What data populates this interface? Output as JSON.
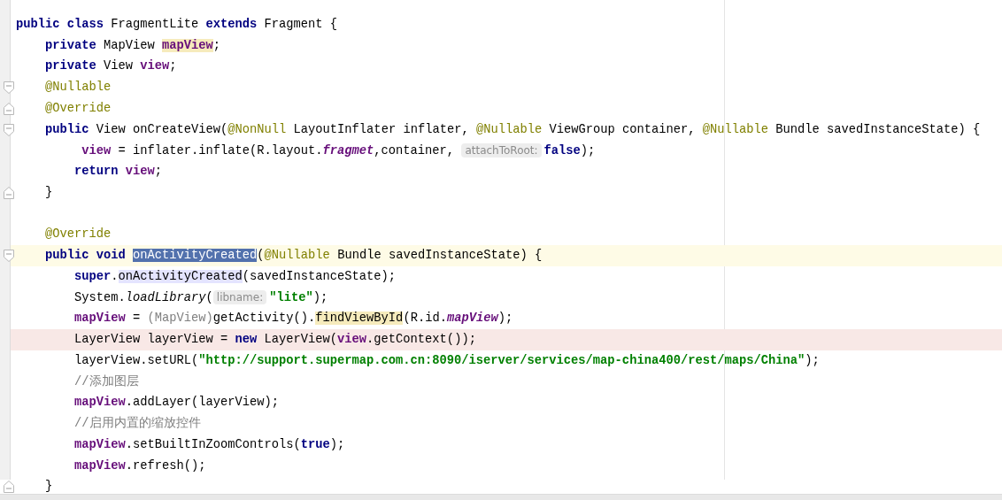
{
  "editor": {
    "lines": [
      {
        "current": false,
        "flagged": false,
        "fold_start": false,
        "fold_end": false,
        "tokens": [
          {
            "kind": "keyword",
            "text": "public class"
          },
          {
            "kind": "plain",
            "text": " FragmentLite "
          },
          {
            "kind": "keyword",
            "text": "extends"
          },
          {
            "kind": "plain",
            "text": " Fragment {"
          }
        ]
      },
      {
        "current": false,
        "flagged": false,
        "fold_start": false,
        "fold_end": false,
        "tokens": [
          {
            "kind": "keyword",
            "text": "    private"
          },
          {
            "kind": "plain",
            "text": " MapView "
          },
          {
            "kind": "usage_field",
            "text": "mapView"
          },
          {
            "kind": "plain",
            "text": ";"
          }
        ]
      },
      {
        "current": false,
        "flagged": false,
        "fold_start": false,
        "fold_end": false,
        "tokens": [
          {
            "kind": "keyword",
            "text": "    private"
          },
          {
            "kind": "plain",
            "text": " View "
          },
          {
            "kind": "field",
            "text": "view"
          },
          {
            "kind": "plain",
            "text": ";"
          }
        ]
      },
      {
        "current": false,
        "flagged": false,
        "fold_start": true,
        "fold_end": false,
        "tokens": [
          {
            "kind": "annotation",
            "text": "    @Nullable"
          }
        ]
      },
      {
        "current": false,
        "flagged": false,
        "fold_start": false,
        "fold_end": true,
        "tokens": [
          {
            "kind": "annotation",
            "text": "    @Override"
          }
        ]
      },
      {
        "current": false,
        "flagged": false,
        "fold_start": true,
        "fold_end": false,
        "tokens": [
          {
            "kind": "keyword",
            "text": "    public"
          },
          {
            "kind": "plain",
            "text": " View onCreateView("
          },
          {
            "kind": "annotation",
            "text": "@NonNull"
          },
          {
            "kind": "plain",
            "text": " LayoutInflater inflater, "
          },
          {
            "kind": "annotation",
            "text": "@Nullable"
          },
          {
            "kind": "plain",
            "text": " ViewGroup container, "
          },
          {
            "kind": "annotation",
            "text": "@Nullable"
          },
          {
            "kind": "plain",
            "text": " Bundle savedInstanceState) {"
          }
        ]
      },
      {
        "current": false,
        "flagged": false,
        "fold_start": false,
        "fold_end": false,
        "tokens": [
          {
            "kind": "field",
            "text": "         view"
          },
          {
            "kind": "plain",
            "text": " = inflater.inflate(R.layout."
          },
          {
            "kind": "static_field",
            "text": "fragmet"
          },
          {
            "kind": "plain",
            "text": ",container, "
          },
          {
            "kind": "hint",
            "text": "attachToRoot:"
          },
          {
            "kind": "keyword",
            "text": "false"
          },
          {
            "kind": "plain",
            "text": ");"
          }
        ]
      },
      {
        "current": false,
        "flagged": false,
        "fold_start": false,
        "fold_end": false,
        "tokens": [
          {
            "kind": "keyword",
            "text": "        return "
          },
          {
            "kind": "field",
            "text": "view"
          },
          {
            "kind": "plain",
            "text": ";"
          }
        ]
      },
      {
        "current": false,
        "flagged": false,
        "fold_start": false,
        "fold_end": true,
        "tokens": [
          {
            "kind": "plain",
            "text": "    }"
          }
        ]
      },
      {
        "current": false,
        "flagged": false,
        "fold_start": false,
        "fold_end": false
      },
      {
        "current": false,
        "flagged": false,
        "fold_start": false,
        "fold_end": false,
        "tokens": [
          {
            "kind": "annotation",
            "text": "    @Override"
          }
        ]
      },
      {
        "current": true,
        "flagged": false,
        "fold_start": true,
        "fold_end": false,
        "tokens": [
          {
            "kind": "keyword",
            "text": "    public void "
          },
          {
            "kind": "selection",
            "text": "onActivityCreated"
          },
          {
            "kind": "plain",
            "text": "("
          },
          {
            "kind": "annotation",
            "text": "@Nullable"
          },
          {
            "kind": "plain",
            "text": " Bundle savedInstanceState) {"
          }
        ]
      },
      {
        "current": false,
        "flagged": false,
        "fold_start": false,
        "fold_end": false,
        "tokens": [
          {
            "kind": "keyword",
            "text": "        super"
          },
          {
            "kind": "plain",
            "text": "."
          },
          {
            "kind": "occurrence",
            "text": "onActivityCreated"
          },
          {
            "kind": "plain",
            "text": "(savedInstanceState);"
          }
        ]
      },
      {
        "current": false,
        "flagged": false,
        "fold_start": false,
        "fold_end": false,
        "tokens": [
          {
            "kind": "plain",
            "text": "        System."
          },
          {
            "kind": "static",
            "text": "loadLibrary"
          },
          {
            "kind": "plain",
            "text": "("
          },
          {
            "kind": "hint",
            "text": "libname:"
          },
          {
            "kind": "string",
            "text": "\"lite\""
          },
          {
            "kind": "plain",
            "text": ");"
          }
        ]
      },
      {
        "current": false,
        "flagged": false,
        "fold_start": false,
        "fold_end": false,
        "tokens": [
          {
            "kind": "field",
            "text": "        mapView"
          },
          {
            "kind": "plain",
            "text": " = "
          },
          {
            "kind": "cast",
            "text": "(MapView)"
          },
          {
            "kind": "plain",
            "text": "getActivity()."
          },
          {
            "kind": "usage",
            "text": "findViewById"
          },
          {
            "kind": "plain",
            "text": "(R.id."
          },
          {
            "kind": "static_field",
            "text": "mapView"
          },
          {
            "kind": "plain",
            "text": ");"
          }
        ]
      },
      {
        "current": false,
        "flagged": true,
        "fold_start": false,
        "fold_end": false,
        "tokens": [
          {
            "kind": "plain",
            "text": "        LayerView layerView = "
          },
          {
            "kind": "keyword",
            "text": "new"
          },
          {
            "kind": "plain",
            "text": " LayerView("
          },
          {
            "kind": "field",
            "text": "view"
          },
          {
            "kind": "plain",
            "text": ".getContext());"
          }
        ]
      },
      {
        "current": false,
        "flagged": false,
        "fold_start": false,
        "fold_end": false,
        "tokens": [
          {
            "kind": "plain",
            "text": "        layerView.setURL("
          },
          {
            "kind": "string",
            "text": "\"http://support.supermap.com.cn:8090/iserver/services/map-china400/rest/maps/China\""
          },
          {
            "kind": "plain",
            "text": ");"
          }
        ]
      },
      {
        "current": false,
        "flagged": false,
        "fold_start": false,
        "fold_end": false,
        "tokens": [
          {
            "kind": "comment",
            "text": "        //添加图层"
          }
        ]
      },
      {
        "current": false,
        "flagged": false,
        "fold_start": false,
        "fold_end": false,
        "tokens": [
          {
            "kind": "field",
            "text": "        mapView"
          },
          {
            "kind": "plain",
            "text": ".addLayer(layerView);"
          }
        ]
      },
      {
        "current": false,
        "flagged": false,
        "fold_start": false,
        "fold_end": false,
        "tokens": [
          {
            "kind": "comment",
            "text": "        //启用内置的缩放控件"
          }
        ]
      },
      {
        "current": false,
        "flagged": false,
        "fold_start": false,
        "fold_end": false,
        "tokens": [
          {
            "kind": "field",
            "text": "        mapView"
          },
          {
            "kind": "plain",
            "text": ".setBuiltInZoomControls("
          },
          {
            "kind": "keyword",
            "text": "true"
          },
          {
            "kind": "plain",
            "text": ");"
          }
        ]
      },
      {
        "current": false,
        "flagged": false,
        "fold_start": false,
        "fold_end": false,
        "tokens": [
          {
            "kind": "field",
            "text": "        mapView"
          },
          {
            "kind": "plain",
            "text": ".refresh();"
          }
        ]
      },
      {
        "current": false,
        "flagged": false,
        "fold_start": false,
        "fold_end": true,
        "tokens": [
          {
            "kind": "plain",
            "text": "    }"
          }
        ]
      }
    ]
  }
}
